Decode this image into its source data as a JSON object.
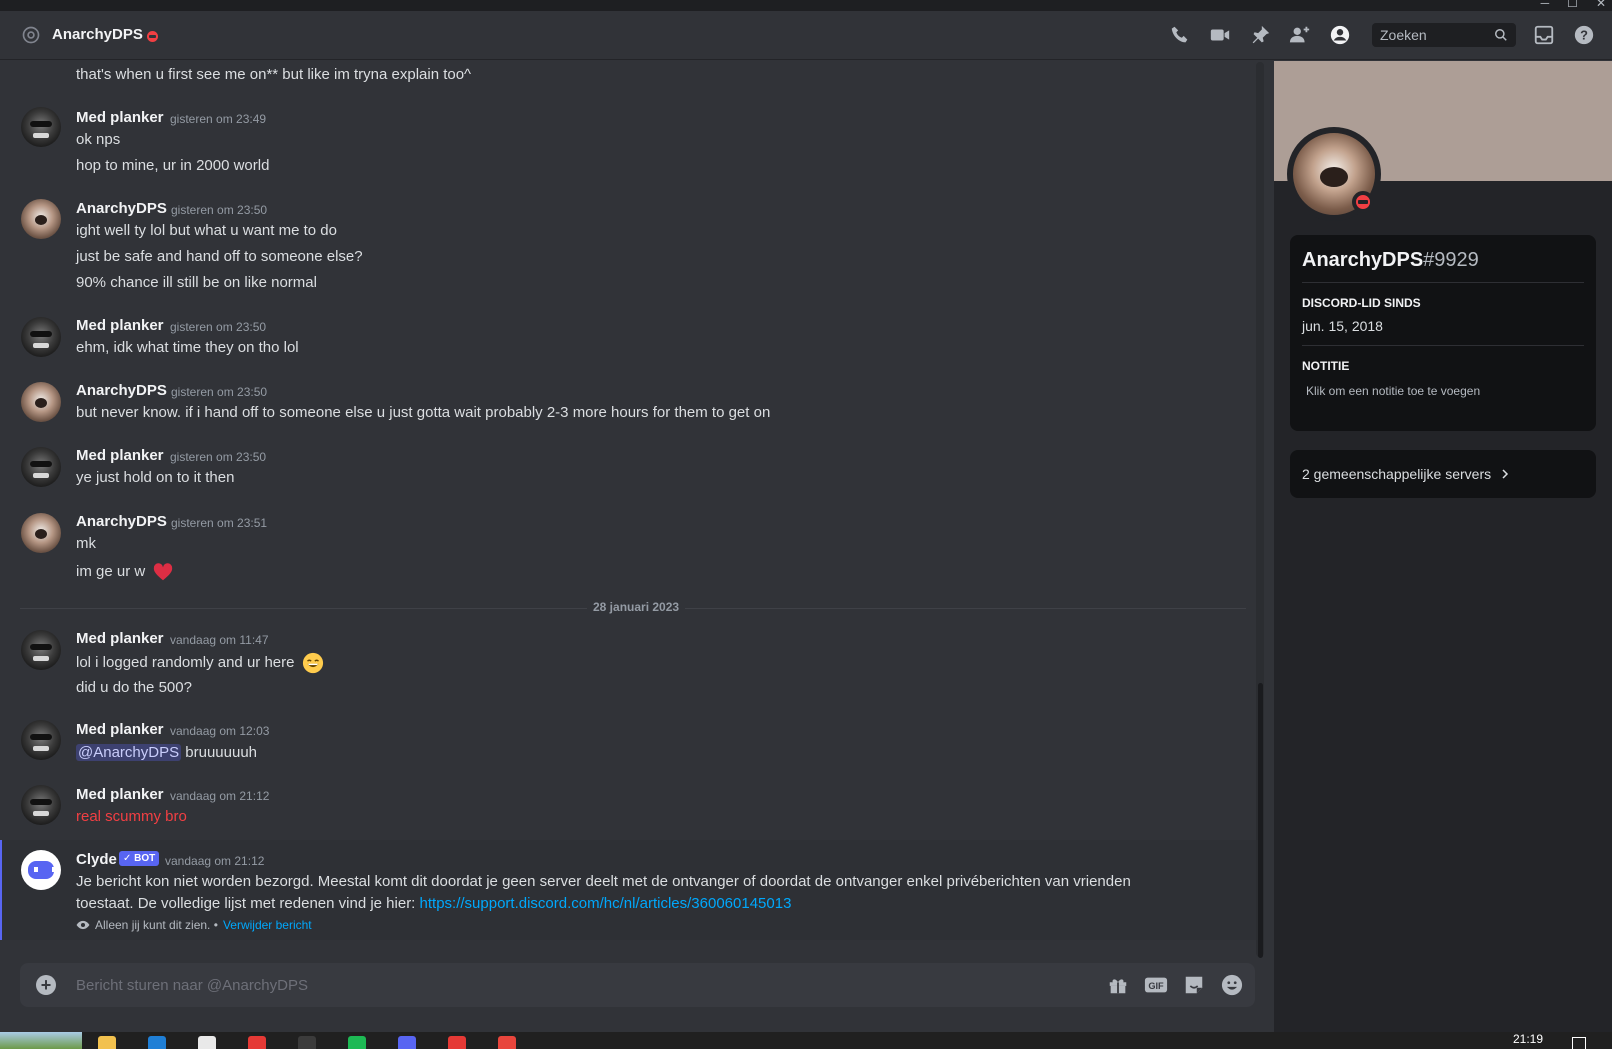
{
  "window": {
    "controls": [
      "─",
      "☐",
      "✕"
    ]
  },
  "header": {
    "title": "AnarchyDPS",
    "search_placeholder": "Zoeken"
  },
  "messages": [
    {
      "lines": [
        "that's when u first see me on** but like im tryna explain too^"
      ]
    },
    {
      "author": "Med planker",
      "time": "gisteren om 23:49",
      "lines": [
        "ok nps",
        "hop to mine, ur in 2000 world"
      ]
    },
    {
      "author": "AnarchyDPS",
      "time": "gisteren om 23:50",
      "lines": [
        "ight well ty lol but what u want me to do",
        "just be safe and hand off to someone else?",
        "90% chance ill still be on like normal"
      ]
    },
    {
      "author": "Med planker",
      "time": "gisteren om 23:50",
      "lines": [
        "ehm, idk what time they on tho lol"
      ]
    },
    {
      "author": "AnarchyDPS",
      "time": "gisteren om 23:50",
      "lines": [
        "but never know.  if i hand off to someone else u just gotta wait probably 2-3 more hours for them to get on"
      ]
    },
    {
      "author": "Med planker",
      "time": "gisteren om 23:50",
      "lines": [
        "ye just hold on to it then"
      ]
    },
    {
      "author": "AnarchyDPS",
      "time": "gisteren om 23:51",
      "lines": [
        "mk",
        "im ge ur w"
      ]
    },
    {
      "author": "Med planker",
      "time": "vandaag om 11:47",
      "lines": [
        "lol i logged randomly and ur here",
        "did u do the 500?"
      ]
    },
    {
      "author": "Med planker",
      "time": "vandaag om 12:03",
      "mention": "@AnarchyDPS",
      "lines": [
        "bruuuuuuh"
      ]
    },
    {
      "author": "Med planker",
      "time": "vandaag om 21:12",
      "lines": [
        "real scummy bro"
      ]
    }
  ],
  "divider": {
    "label": "28 januari 2023"
  },
  "clyde": {
    "author": "Clyde",
    "bot_tag": "✓ BOT",
    "time": "vandaag om 21:12",
    "line1": "Je bericht kon niet worden bezorgd. Meestal komt dit doordat je geen server deelt met de ontvanger of doordat de ontvanger enkel privéberichten van vrienden",
    "line2": "toestaat. De volledige lijst met redenen vind je hier:",
    "link": "https://support.discord.com/hc/nl/articles/360060145013",
    "only_you": "Alleen jij kunt dit zien. •",
    "delete_link": "Verwijder bericht"
  },
  "composer": {
    "placeholder": "Bericht sturen naar @AnarchyDPS",
    "gif_label": "GIF"
  },
  "profile": {
    "username": "AnarchyDPS",
    "discriminator": "#9929",
    "member_since_label": "DISCORD-LID SINDS",
    "member_since": "jun. 15, 2018",
    "note_label": "NOTITIE",
    "note_placeholder": "Klik om een notitie toe te voegen",
    "mutual_servers": "2 gemeenschappelijke servers"
  },
  "taskbar": {
    "time": "21:19"
  },
  "colors": {
    "accent": "#5865f2",
    "dnd": "#f23f43",
    "link": "#00a8fc",
    "background": "#313338"
  }
}
